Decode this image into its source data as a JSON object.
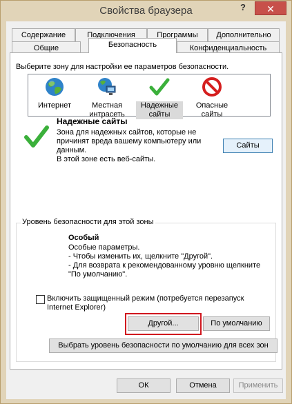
{
  "window": {
    "title": "Свойства браузера",
    "help_glyph": "?",
    "close_glyph": "✕"
  },
  "tabs_row1": [
    "Содержание",
    "Подключения",
    "Программы",
    "Дополнительно"
  ],
  "tabs_row2": [
    "Общие",
    "Безопасность",
    "Конфиденциальность"
  ],
  "zones": {
    "caption": "Выберите зону для настройки ее параметров безопасности.",
    "items": [
      {
        "label1": "Интернет",
        "label2": "",
        "icon": "globe-icon"
      },
      {
        "label1": "Местная",
        "label2": "интрасеть",
        "icon": "intranet-icon"
      },
      {
        "label1": "Надежные",
        "label2": "сайты",
        "icon": "checkmark-icon"
      },
      {
        "label1": "Опасные",
        "label2": "сайты",
        "icon": "blocked-icon"
      }
    ]
  },
  "selected_zone": {
    "name": "Надежные сайты",
    "line1": "Зона для надежных сайтов, которые не",
    "line2": "причинят вреда вашему компьютеру или",
    "line3": "данным.",
    "line4": "В этой зоне есть веб-сайты.",
    "sites_button": "Сайты"
  },
  "security_level": {
    "group_label": "Уровень безопасности для этой зоны",
    "name": "Особый",
    "line1": "Особые параметры.",
    "line2": "- Чтобы изменить их, щелкните \"Другой\".",
    "line3": "- Для возврата к рекомендованному уровню щелкните",
    "line4": "\"По умолчанию\".",
    "protected_mode_line1": "Включить защищенный режим (потребуется перезапуск",
    "protected_mode_line2": "Internet Explorer)",
    "protected_mode_checked": false,
    "custom_button": "Другой...",
    "default_button": "По умолчанию",
    "reset_all_button": "Выбрать уровень безопасности по умолчанию для всех зон"
  },
  "footer": {
    "ok": "ОК",
    "cancel": "Отмена",
    "apply": "Применить"
  },
  "colors": {
    "highlight_frame": "#d0161e",
    "close_button": "#c7504a",
    "frame": "#e1d4b8"
  }
}
